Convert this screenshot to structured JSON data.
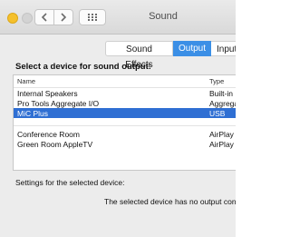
{
  "window": {
    "title": "Sound"
  },
  "tabs": [
    {
      "label": "Sound Effects"
    },
    {
      "label": "Output"
    },
    {
      "label": "Input"
    }
  ],
  "output": {
    "section_label": "Select a device for sound output:",
    "columns": {
      "name": "Name",
      "type": "Type"
    },
    "devices": [
      {
        "name": "Internal Speakers",
        "type": "Built-in"
      },
      {
        "name": "Pro Tools Aggregate I/O",
        "type": "Aggrega"
      },
      {
        "name": "MiC Plus",
        "type": "USB",
        "selected": true
      },
      {
        "name": "Conference Room",
        "type": "AirPlay"
      },
      {
        "name": "Green Room AppleTV",
        "type": "AirPlay"
      }
    ],
    "settings_label": "Settings for the selected device:",
    "settings_message": "The selected device has no output cont"
  },
  "colors": {
    "selection": "#2f6fd3",
    "tab_active": "#3b8fe6"
  },
  "icons": [
    "back-chevron-icon",
    "forward-chevron-icon",
    "grid-icon"
  ]
}
